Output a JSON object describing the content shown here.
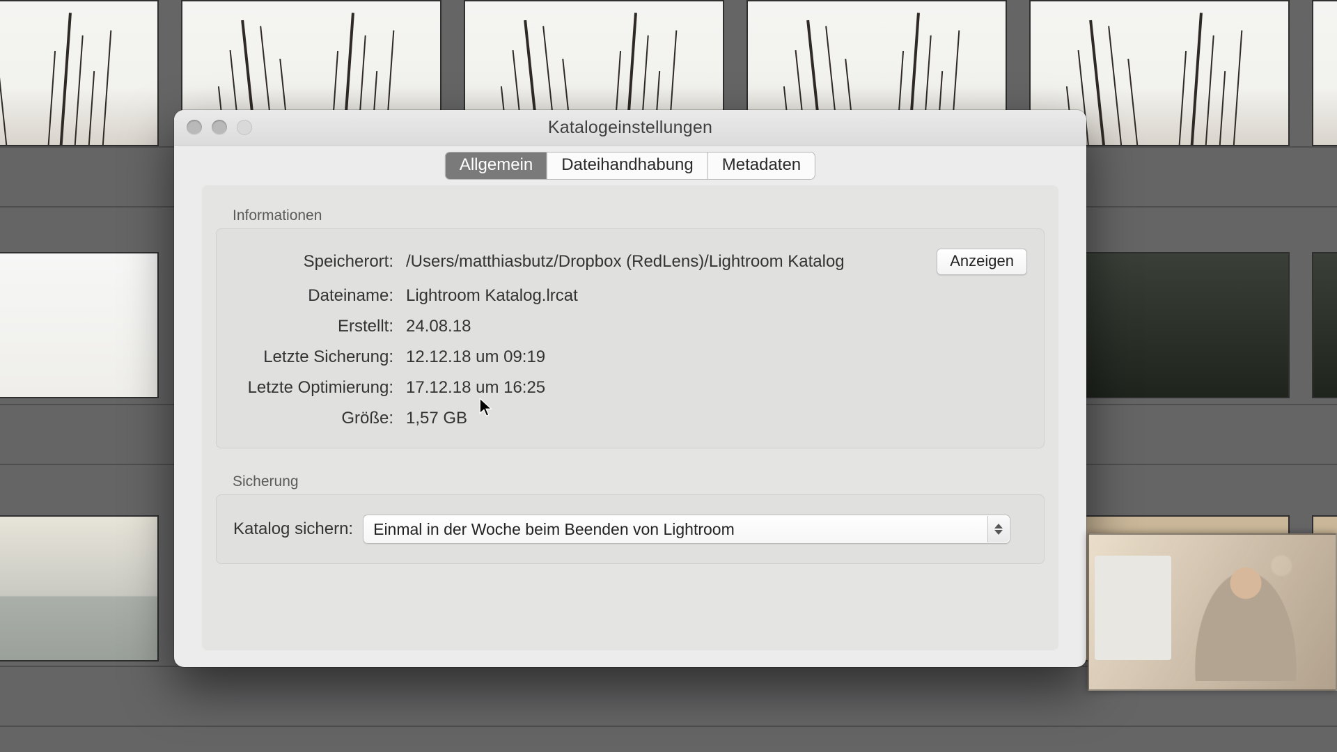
{
  "window": {
    "title": "Katalogeinstellungen"
  },
  "tabs": [
    {
      "label": "Allgemein",
      "selected": true
    },
    {
      "label": "Dateihandhabung",
      "selected": false
    },
    {
      "label": "Metadaten",
      "selected": false
    }
  ],
  "sections": {
    "info_heading": "Informationen",
    "backup_heading": "Sicherung"
  },
  "info": {
    "location_label": "Speicherort:",
    "location_value": "/Users/matthiasbutz/Dropbox (RedLens)/Lightroom Katalog",
    "show_button": "Anzeigen",
    "filename_label": "Dateiname:",
    "filename_value": "Lightroom Katalog.lrcat",
    "created_label": "Erstellt:",
    "created_value": "24.08.18",
    "lastbackup_label": "Letzte Sicherung:",
    "lastbackup_value": "12.12.18 um 09:19",
    "lastopt_label": "Letzte Optimierung:",
    "lastopt_value": "17.12.18 um 16:25",
    "size_label": "Größe:",
    "size_value": "1,57 GB"
  },
  "backup": {
    "label": "Katalog sichern:",
    "value": "Einmal in der Woche beim Beenden von Lightroom"
  }
}
